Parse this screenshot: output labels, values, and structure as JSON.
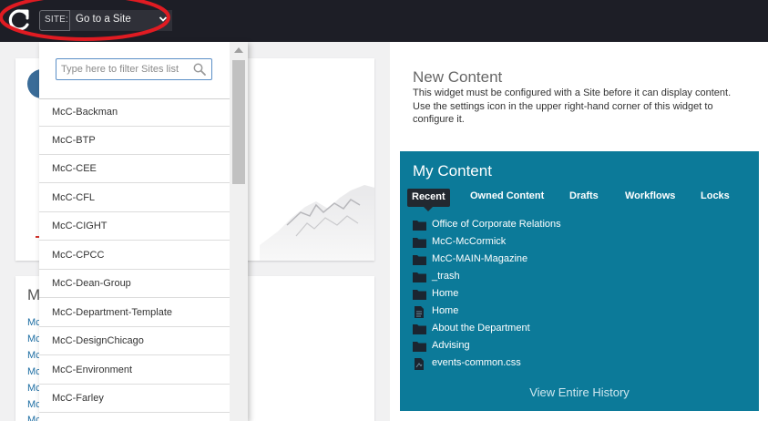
{
  "topbar": {
    "logo_icon": "refresh-c-logo-icon",
    "site_label": "SITE:",
    "site_select_value": "Go to a Site",
    "highlight_color": "#e01b22"
  },
  "dropdown": {
    "filter_placeholder": "Type here to filter Sites list",
    "items": [
      {
        "label": "McC-Backman"
      },
      {
        "label": "McC-BTP"
      },
      {
        "label": "McC-CEE"
      },
      {
        "label": "McC-CFL"
      },
      {
        "label": "McC-CIGHT"
      },
      {
        "label": "McC-CPCC"
      },
      {
        "label": "McC-Dean-Group"
      },
      {
        "label": "McC-Department-Template"
      },
      {
        "label": "McC-DesignChicago"
      },
      {
        "label": "McC-Environment"
      },
      {
        "label": "McC-Farley"
      }
    ]
  },
  "card2": {
    "title_fragment": "M",
    "link_fragments": [
      "Mc",
      "Mc",
      "Mc",
      "Mc",
      "Mc",
      "Mc",
      "Mc"
    ]
  },
  "new_content": {
    "title": "New Content",
    "text": "This widget must be configured with a Site before it can display content. Use the settings icon in the upper right-hand corner of this widget to configure it."
  },
  "my_content": {
    "title": "My Content",
    "tabs": [
      {
        "label": "Recent",
        "active": true
      },
      {
        "label": "Owned Content"
      },
      {
        "label": "Drafts"
      },
      {
        "label": "Workflows"
      },
      {
        "label": "Locks"
      }
    ],
    "items": [
      {
        "label": "Office of Corporate Relations",
        "icon": "folder-icon"
      },
      {
        "label": "McC-McCormick",
        "icon": "folder-icon"
      },
      {
        "label": "McC-MAIN-Magazine",
        "icon": "folder-icon"
      },
      {
        "label": "_trash",
        "icon": "folder-icon"
      },
      {
        "label": "Home",
        "icon": "folder-icon"
      },
      {
        "label": "Home",
        "icon": "page-icon"
      },
      {
        "label": "About the Department",
        "icon": "folder-icon"
      },
      {
        "label": "Advising",
        "icon": "folder-icon"
      },
      {
        "label": "events-common.css",
        "icon": "file-icon"
      }
    ],
    "footer_link": "View Entire History",
    "background_color": "#0c7a99"
  }
}
